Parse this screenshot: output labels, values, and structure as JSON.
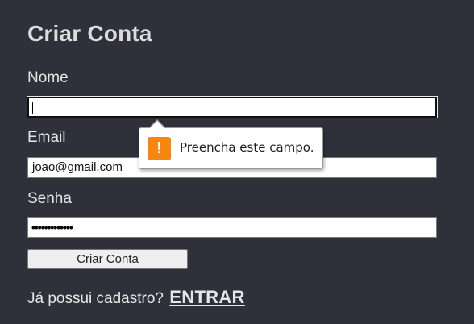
{
  "form": {
    "title": "Criar Conta",
    "name_label": "Nome",
    "name_value": "",
    "email_label": "Email",
    "email_value": "joao@gmail.com",
    "password_label": "Senha",
    "password_mask": "•••••••••••••",
    "submit_label": "Criar Conta"
  },
  "validation_tooltip": {
    "icon": "warning-icon",
    "icon_glyph": "!",
    "message": "Preencha este campo."
  },
  "footer": {
    "prompt": "Já possui cadastro?",
    "login_link": "ENTRAR"
  },
  "colors": {
    "background": "#30303b",
    "text": "#e6e6e6",
    "warning": "#f5870f"
  }
}
